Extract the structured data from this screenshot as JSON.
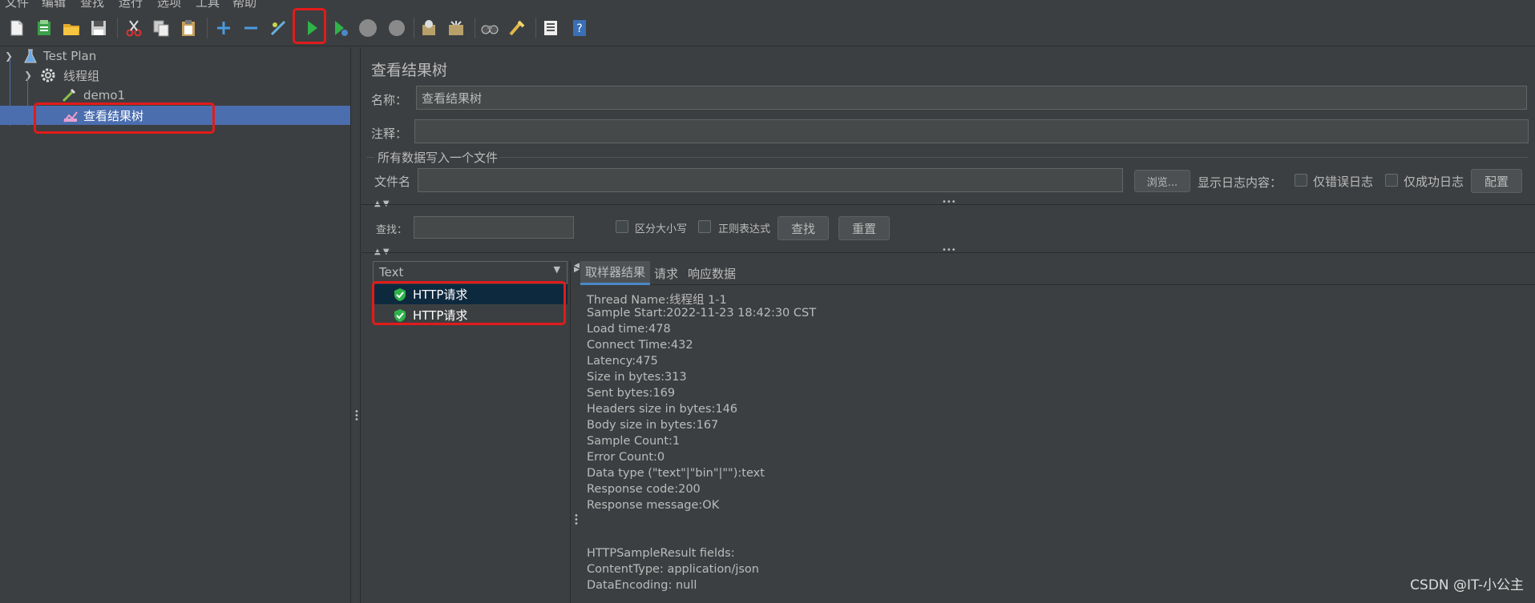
{
  "menubar": [
    "文件",
    "编辑",
    "查找",
    "运行",
    "选项",
    "工具",
    "帮助"
  ],
  "tree": {
    "items": [
      {
        "label": "Test Plan",
        "icon": "flask-icon"
      },
      {
        "label": "线程组",
        "icon": "gear-icon"
      },
      {
        "label": "demo1",
        "icon": "pipette-icon"
      },
      {
        "label": "查看结果树",
        "icon": "graph-icon"
      }
    ]
  },
  "panel": {
    "title": "查看结果树",
    "name_label": "名称：",
    "name_value": "查看结果树",
    "comment_label": "注释：",
    "comment_value": "",
    "file_section": "所有数据写入一个文件",
    "filename_label": "文件名",
    "filename_value": "",
    "browse_label": "浏览...",
    "log_label": "显示日志内容：",
    "errors_only_label": "仅错误日志",
    "success_only_label": "仅成功日志",
    "config_label": "配置",
    "search_label": "查找：",
    "search_value": "",
    "case_label": "区分大小写",
    "regex_label": "正则表达式",
    "find_label": "查找",
    "reset_label": "重置"
  },
  "results": {
    "renderer": "Text",
    "items": [
      "HTTP请求",
      "HTTP请求"
    ]
  },
  "tabs": [
    "取样器结果",
    "请求",
    "响应数据"
  ],
  "detail": [
    "Thread Name:线程组 1-1",
    "Sample Start:2022-11-23 18:42:30 CST",
    "Load time:478",
    "Connect Time:432",
    "Latency:475",
    "Size in bytes:313",
    "Sent bytes:169",
    "Headers size in bytes:146",
    "Body size in bytes:167",
    "Sample Count:1",
    "Error Count:0",
    "Data type (\"text\"|\"bin\"|\"\"):text",
    "Response code:200",
    "Response message:OK",
    "",
    "",
    "HTTPSampleResult fields:",
    "ContentType: application/json",
    "DataEncoding: null"
  ],
  "watermark": "CSDN @IT-小公主",
  "colors": {
    "selection": "#4b6eaf",
    "highlight": "#e21b1b",
    "success": "#2fb34a"
  }
}
